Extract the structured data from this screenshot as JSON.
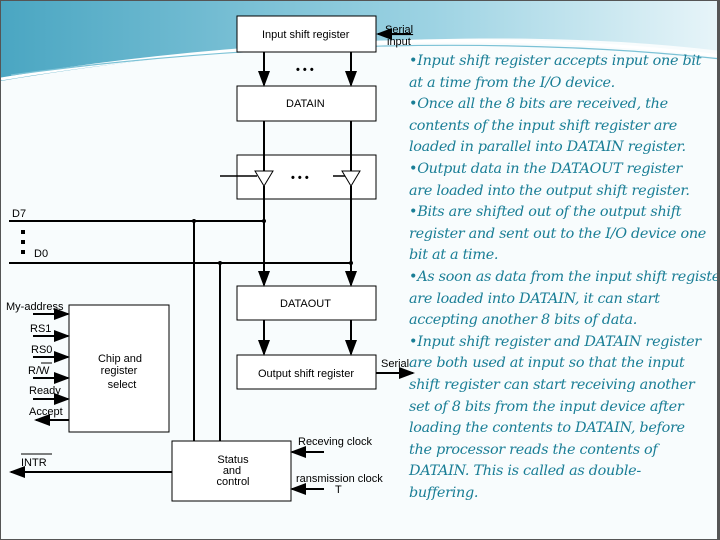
{
  "diagram": {
    "input_shift_register": "Input shift register",
    "serial_in_top": "Serial",
    "serial_in_bottom": "input",
    "dots": "• • •",
    "datain": "DATAIN",
    "d7": "D7",
    "d0": "D0",
    "dataout": "DATAOUT",
    "output_shift_register": "Output shift register",
    "serial_out": "Serial",
    "my_address": "My-address",
    "rs1": "RS1",
    "rs0": "RS0",
    "rw": "R/W",
    "ready": "Ready",
    "accept": "Accept",
    "chip_select": [
      "Chip and",
      "register",
      "select"
    ],
    "intr": "INTR",
    "status_control": [
      "Status",
      "and",
      "control"
    ],
    "receiving_clock": "Receving clock",
    "transmission_clock": "ransmission clock",
    "transmission_t": "T"
  },
  "notes": [
    "•Input shift register accepts input one bit",
    " at a time from the I/O device.",
    "•Once all the 8 bits are received, the",
    "contents of the input shift register are",
    "loaded in parallel into DATAIN register.",
    "•Output data in the DATAOUT register",
    "are loaded into the output shift register.",
    "•Bits are shifted out of the output shift",
    "register and sent out to the I/O device one",
    "bit at a time.",
    "•As soon as data from the input shift register",
    "are loaded into DATAIN, it can start",
    "accepting another 8 bits of data.",
    "•Input shift register and DATAIN register",
    "are both used at input so that the input",
    "shift register can start receiving another",
    "set of 8 bits from the input device after",
    "loading the contents to DATAIN, before",
    "the processor reads the contents of",
    "DATAIN. This is called as double-",
    "buffering."
  ],
  "colors": {
    "text": "#1a7e96",
    "swoosh": "#5fb3cc"
  }
}
